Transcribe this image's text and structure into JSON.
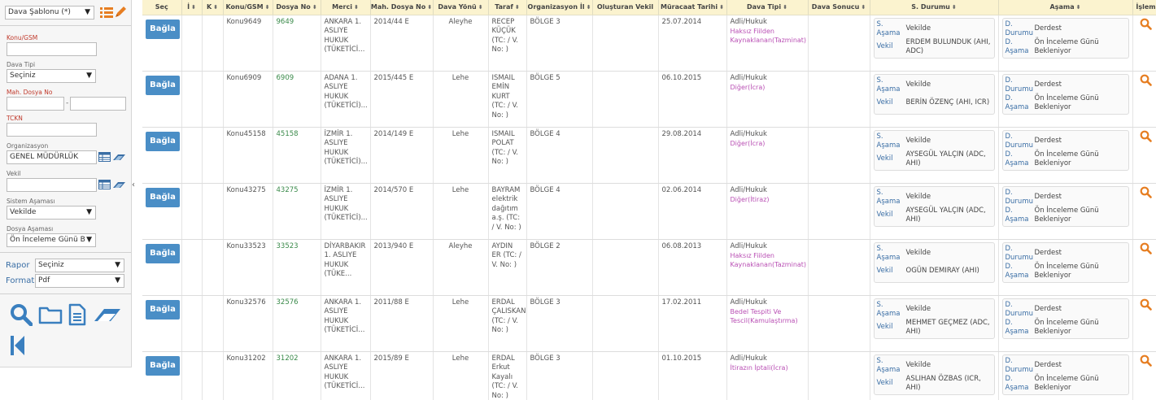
{
  "sidebar": {
    "template_select": "Dava Şablonu (*)",
    "labels": {
      "konu_gsm": "Konu/GSM",
      "dava_tipi": "Dava Tipi",
      "mah_dosya_no": "Mah. Dosya No",
      "tckn": "TCKN",
      "organizasyon": "Organizasyon",
      "vekil": "Vekil",
      "sistem_asamasi": "Sistem Aşaması",
      "dosya_asamasi": "Dosya Aşaması"
    },
    "values": {
      "konu_gsm": "",
      "dava_tipi": "Seçiniz",
      "mah_dosya_no_1": "",
      "mah_dosya_no_sep": "-",
      "mah_dosya_no_2": "",
      "tckn": "",
      "organizasyon": "GENEL MÜDÜRLÜK",
      "vekil": "",
      "sistem_asamasi": "Vekilde",
      "dosya_asamasi": "Ön İnceleme Günü B"
    },
    "report": {
      "rapor_label": "Rapor",
      "rapor_value": "Seçiniz",
      "format_label": "Format",
      "format_value": "Pdf"
    }
  },
  "table": {
    "headers": [
      "Seç",
      "İ",
      "K",
      "Konu/GSM",
      "Dosya No",
      "Merci",
      "Mah. Dosya No",
      "Dava Yönü",
      "Taraf",
      "Organizasyon İl",
      "Oluşturan Vekil",
      "Müracaat Tarihi",
      "Dava Tipi",
      "Dava Sonucu",
      "S. Durumu",
      "Aşama",
      "İşlem"
    ],
    "button_label": "Bağla",
    "rows": [
      {
        "konu": "Konu9649",
        "dosya": "9649",
        "merci": "ANKARA 1. ASLIYE HUKUK (TÜKETİCİ...",
        "mah": "2014/44 E",
        "yon": "Aleyhe",
        "taraf": "RECEP KÜÇÜK (TC: / V. No: )",
        "org": "BÖLGE 3",
        "vekil_olusturan": "",
        "tarih": "25.07.2014",
        "tip": "Adli/Hukuk",
        "tip_sub": "Haksız Fiilden Kaynaklanan(Tazminat)",
        "sonuc": "",
        "s_asama_k": "S. Aşama",
        "s_asama_v": "Vekilde",
        "s_vekil_k": "Vekil",
        "s_vekil_v": "ERDEM BULUNDUK (AHI, ADC)",
        "d_durum_k": "D. Durumu",
        "d_durum_v": "Derdest",
        "d_asama_k": "D. Aşama",
        "d_asama_v": "Ön İnceleme Günü Bekleniyor"
      },
      {
        "konu": "Konu6909",
        "dosya": "6909",
        "merci": "ADANA 1. ASLIYE HUKUK (TÜKETİCİ)...",
        "mah": "2015/445 E",
        "yon": "Lehe",
        "taraf": "ISMAIL EMİN KURT (TC: / V. No: )",
        "org": "BÖLGE 5",
        "vekil_olusturan": "",
        "tarih": "06.10.2015",
        "tip": "Adli/Hukuk",
        "tip_sub": "Diğer(İcra)",
        "sonuc": "",
        "s_asama_k": "S. Aşama",
        "s_asama_v": "Vekilde",
        "s_vekil_k": "Vekil",
        "s_vekil_v": "BERİN ÖZENÇ (AHI, ICR)",
        "d_durum_k": "D. Durumu",
        "d_durum_v": "Derdest",
        "d_asama_k": "D. Aşama",
        "d_asama_v": "Ön İnceleme Günü Bekleniyor"
      },
      {
        "konu": "Konu45158",
        "dosya": "45158",
        "merci": "İZMİR 1. ASLIYE HUKUK (TÜKETİCİ)...",
        "mah": "2014/149 E",
        "yon": "Lehe",
        "taraf": "ISMAIL POLAT (TC: / V. No: )",
        "org": "BÖLGE 4",
        "vekil_olusturan": "",
        "tarih": "29.08.2014",
        "tip": "Adli/Hukuk",
        "tip_sub": "Diğer(İcra)",
        "sonuc": "",
        "s_asama_k": "S. Aşama",
        "s_asama_v": "Vekilde",
        "s_vekil_k": "Vekil",
        "s_vekil_v": "AYSEGÜL YALÇIN (ADC, AHI)",
        "d_durum_k": "D. Durumu",
        "d_durum_v": "Derdest",
        "d_asama_k": "D. Aşama",
        "d_asama_v": "Ön İnceleme Günü Bekleniyor"
      },
      {
        "konu": "Konu43275",
        "dosya": "43275",
        "merci": "İZMİR 1. ASLIYE HUKUK (TÜKETİCİ)...",
        "mah": "2014/570 E",
        "yon": "Lehe",
        "taraf": "BAYRAM elektrik dağıtım a.ş. (TC: / V. No: )",
        "org": "BÖLGE 4",
        "vekil_olusturan": "",
        "tarih": "02.06.2014",
        "tip": "Adli/Hukuk",
        "tip_sub": "Diğer(İtiraz)",
        "sonuc": "",
        "s_asama_k": "S. Aşama",
        "s_asama_v": "Vekilde",
        "s_vekil_k": "Vekil",
        "s_vekil_v": "AYSEGÜL YALÇIN (ADC, AHI)",
        "d_durum_k": "D. Durumu",
        "d_durum_v": "Derdest",
        "d_asama_k": "D. Aşama",
        "d_asama_v": "Ön İnceleme Günü Bekleniyor"
      },
      {
        "konu": "Konu33523",
        "dosya": "33523",
        "merci": "DİYARBAKIR 1. ASLIYE HUKUK (TÜKE...",
        "mah": "2013/940 E",
        "yon": "Aleyhe",
        "taraf": "AYDIN ER (TC: / V. No: )",
        "org": "BÖLGE 2",
        "vekil_olusturan": "",
        "tarih": "06.08.2013",
        "tip": "Adli/Hukuk",
        "tip_sub": "Haksız Fiilden Kaynaklanan(Tazminat)",
        "sonuc": "",
        "s_asama_k": "S. Aşama",
        "s_asama_v": "Vekilde",
        "s_vekil_k": "Vekil",
        "s_vekil_v": "OGÜN DEMIRAY (AHI)",
        "d_durum_k": "D. Durumu",
        "d_durum_v": "Derdest",
        "d_asama_k": "D. Aşama",
        "d_asama_v": "Ön İnceleme Günü Bekleniyor"
      },
      {
        "konu": "Konu32576",
        "dosya": "32576",
        "merci": "ANKARA 1. ASLIYE HUKUK (TÜKETİCİ...",
        "mah": "2011/88 E",
        "yon": "Lehe",
        "taraf": "ERDAL ÇALISKAN (TC: / V. No: )",
        "org": "BÖLGE 3",
        "vekil_olusturan": "",
        "tarih": "17.02.2011",
        "tip": "Adli/Hukuk",
        "tip_sub": "Bedel Tespiti Ve Tescil(Kamulaştırma)",
        "sonuc": "",
        "s_asama_k": "S. Aşama",
        "s_asama_v": "Vekilde",
        "s_vekil_k": "Vekil",
        "s_vekil_v": "MEHMET GEÇMEZ (ADC, AHI)",
        "d_durum_k": "D. Durumu",
        "d_durum_v": "Derdest",
        "d_asama_k": "D. Aşama",
        "d_asama_v": "Ön İnceleme Günü Bekleniyor"
      },
      {
        "konu": "Konu31202",
        "dosya": "31202",
        "merci": "ANKARA 1. ASLIYE HUKUK (TÜKETİCİ...",
        "mah": "2015/89 E",
        "yon": "Lehe",
        "taraf": "ERDAL Erkut Kayalı (TC: / V. No: )",
        "org": "BÖLGE 3",
        "vekil_olusturan": "",
        "tarih": "01.10.2015",
        "tip": "Adli/Hukuk",
        "tip_sub": "İtirazın İptali(İcra)",
        "sonuc": "",
        "s_asama_k": "S. Aşama",
        "s_asama_v": "Vekilde",
        "s_vekil_k": "Vekil",
        "s_vekil_v": "ASLIHAN ÖZBAS (ICR, AHI)",
        "d_durum_k": "D. Durumu",
        "d_durum_v": "Derdest",
        "d_asama_k": "D. Aşama",
        "d_asama_v": "Ön İnceleme Günü Bekleniyor"
      }
    ]
  },
  "icons": {
    "list": "list-icon",
    "edit": "pencil-icon",
    "table": "table-icon",
    "eraser": "eraser-icon",
    "search": "search-icon",
    "folder": "folder-icon",
    "document": "document-icon",
    "first": "first-page-icon",
    "row_search": "magnifier-icon",
    "collapse": "collapse-arrow-icon"
  },
  "colors": {
    "header_bg": "#fbf3cf",
    "button": "#4a8ec6",
    "accent_orange": "#e67e22",
    "tip_sub": "#b94fb4",
    "dosya_no": "#3a8a4a",
    "label_blue": "#3a6ea5"
  }
}
